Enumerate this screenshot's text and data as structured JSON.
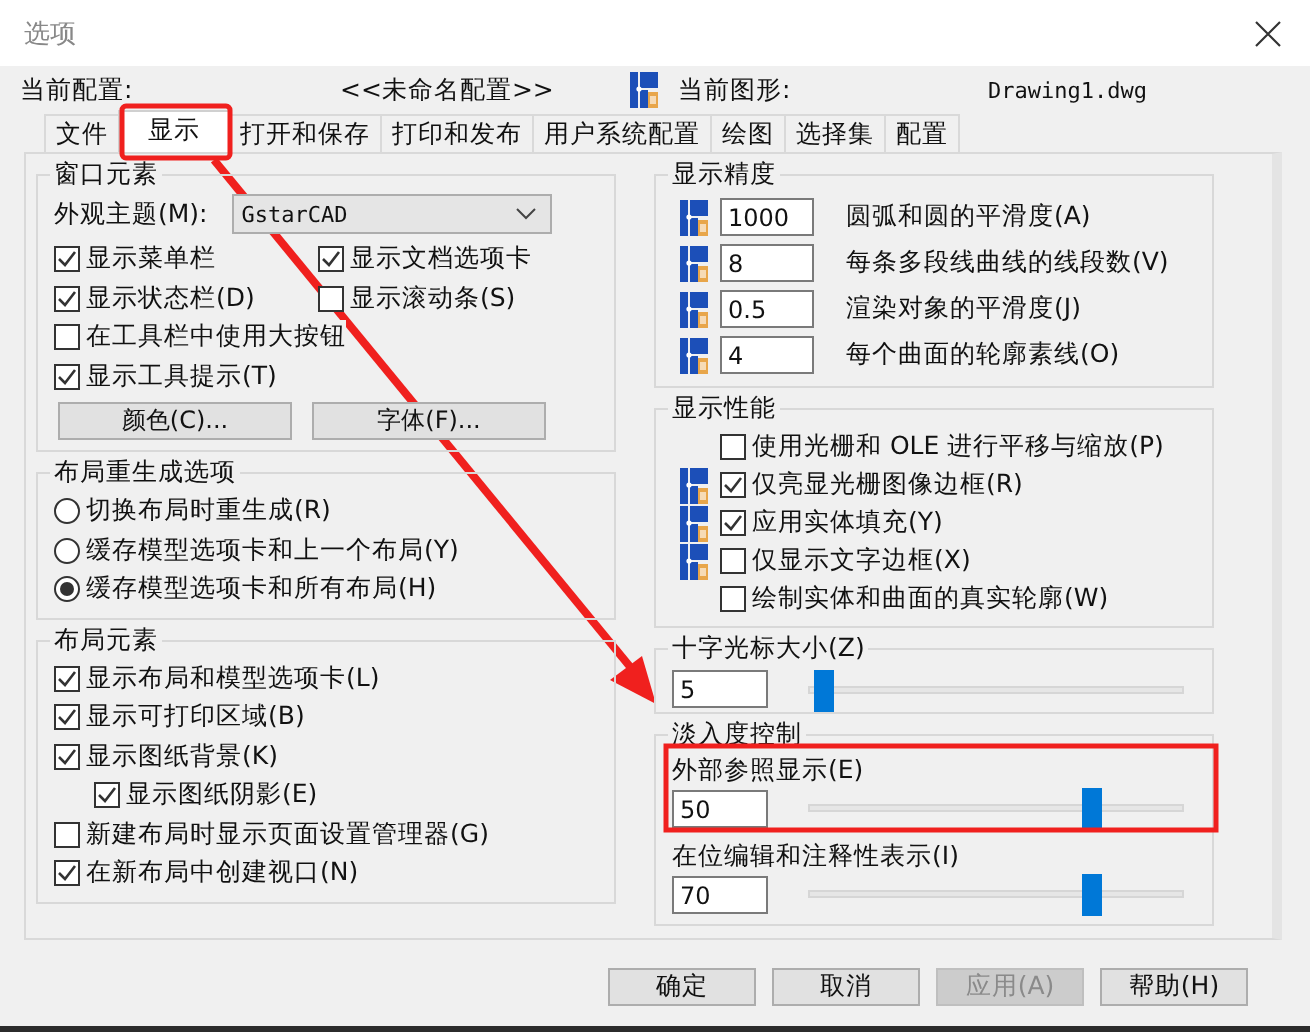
{
  "window": {
    "title": "选项"
  },
  "header": {
    "profile_label": "当前配置:",
    "profile": "<<未命名配置>>",
    "drawing_label": "当前图形:",
    "drawing": "Drawing1.dwg"
  },
  "tabs": [
    {
      "label": "文件",
      "selected": false
    },
    {
      "label": "显示",
      "selected": true
    },
    {
      "label": "打开和保存",
      "selected": false
    },
    {
      "label": "打印和发布",
      "selected": false
    },
    {
      "label": "用户系统配置",
      "selected": false
    },
    {
      "label": "绘图",
      "selected": false
    },
    {
      "label": "选择集",
      "selected": false
    },
    {
      "label": "配置",
      "selected": false
    }
  ],
  "window_elements": {
    "title": "窗口元素",
    "theme_label": "外观主题(M):",
    "theme": "GstarCAD",
    "rows": [
      [
        {
          "label": "显示菜单栏",
          "checked": true
        },
        {
          "label": "显示文档选项卡",
          "checked": true
        }
      ],
      [
        {
          "label": "显示状态栏(D)",
          "checked": true
        },
        {
          "label": "显示滚动条(S)",
          "checked": false
        }
      ],
      [
        {
          "label": "在工具栏中使用大按钮",
          "checked": false
        }
      ],
      [
        {
          "label": "显示工具提示(T)",
          "checked": true
        }
      ]
    ],
    "buttons": [
      "颜色(C)...",
      "字体(F)..."
    ]
  },
  "layout_regen": {
    "title": "布局重生成选项",
    "options": [
      {
        "label": "切换布局时重生成(R)",
        "selected": false
      },
      {
        "label": "缓存模型选项卡和上一个布局(Y)",
        "selected": false
      },
      {
        "label": "缓存模型选项卡和所有布局(H)",
        "selected": true
      }
    ]
  },
  "layout_elements": {
    "title": "布局元素",
    "options": [
      {
        "label": "显示布局和模型选项卡(L)",
        "checked": true
      },
      {
        "label": "显示可打印区域(B)",
        "checked": true
      },
      {
        "label": "显示图纸背景(K)",
        "checked": true,
        "children": [
          {
            "label": "显示图纸阴影(E)",
            "checked": true
          }
        ]
      },
      {
        "label": "新建布局时显示页面设置管理器(G)",
        "checked": false
      },
      {
        "label": "在新布局中创建视口(N)",
        "checked": true
      }
    ]
  },
  "display_resolution": {
    "title": "显示精度",
    "rows": [
      {
        "value": "1000",
        "label": "圆弧和圆的平滑度(A)",
        "drawing_icon": true
      },
      {
        "value": "8",
        "label": "每条多段线曲线的线段数(V)",
        "drawing_icon": true
      },
      {
        "value": "0.5",
        "label": "渲染对象的平滑度(J)",
        "drawing_icon": true
      },
      {
        "value": "4",
        "label": "每个曲面的轮廓素线(O)",
        "drawing_icon": true
      }
    ]
  },
  "display_performance": {
    "title": "显示性能",
    "options": [
      {
        "label": "使用光栅和 OLE 进行平移与缩放(P)",
        "checked": false,
        "drawing_icon": false
      },
      {
        "label": "仅亮显光栅图像边框(R)",
        "checked": true,
        "drawing_icon": true
      },
      {
        "label": "应用实体填充(Y)",
        "checked": true,
        "drawing_icon": true
      },
      {
        "label": "仅显示文字边框(X)",
        "checked": false,
        "drawing_icon": true
      },
      {
        "label": "绘制实体和曲面的真实轮廓(W)",
        "checked": false,
        "drawing_icon": false
      }
    ]
  },
  "crosshair": {
    "title": "十字光标大小(Z)",
    "value": "5",
    "level": 0.04
  },
  "fade": {
    "title": "淡入度控制",
    "items": [
      {
        "label": "外部参照显示(E)",
        "value": "50",
        "level": 0.76
      },
      {
        "label": "在位编辑和注释性表示(I)",
        "value": "70",
        "level": 0.76
      }
    ]
  },
  "buttons": [
    {
      "label": "确定",
      "disabled": false
    },
    {
      "label": "取消",
      "disabled": false
    },
    {
      "label": "应用(A)",
      "disabled": true
    },
    {
      "label": "帮助(H)",
      "disabled": false
    }
  ]
}
